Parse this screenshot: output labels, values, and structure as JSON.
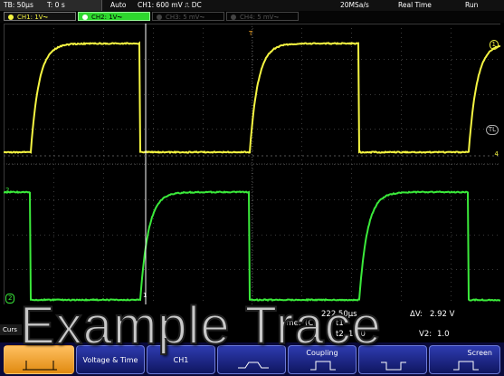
{
  "status_bar": {
    "timebase": "TB: 50µs",
    "trigger_time": "T: 0 s",
    "trigger_mode": "Auto",
    "trigger_info": "CH1: 600 mV ⎍ DC",
    "sample_rate": "20MSa/s",
    "acq_mode": "Real Time",
    "run_state": "Run"
  },
  "channel_tabs": [
    {
      "label": "CH1: 1V⏦",
      "active": false,
      "color": "#f5f542"
    },
    {
      "label": "CH2: 1V⏦",
      "active": true,
      "color": "#3bea3b"
    },
    {
      "label": "CH3: 5 mV⏦",
      "active": false,
      "color": "#555555"
    },
    {
      "label": "CH4: 5 mV⏦",
      "active": false,
      "color": "#555555"
    }
  ],
  "markers": {
    "ch1_right": "1",
    "ch1_level_right": "4",
    "ch2_zero_left": "2",
    "trigger_letter": "T",
    "trigger_right": "TL",
    "cursor_label": "1",
    "ch2_ground": "2"
  },
  "readout": {
    "time_label": "Time:",
    "channel": "(CH",
    "t1_label": "t1",
    "t1_value": "222.50µs",
    "t2_label": "t2",
    "t2_value": "1.50",
    "dv_label": "ΔV:",
    "dv_value": "2.92 V",
    "v2_label": "V2:",
    "v2_value": "1.0"
  },
  "cursors_tab": "Curs",
  "softkeys": [
    {
      "label": "",
      "icon": "cursor-type-icon",
      "active": true
    },
    {
      "label": "Voltage & Time",
      "icon": "",
      "active": false
    },
    {
      "label": "CH1",
      "icon": "",
      "active": false
    },
    {
      "label": "",
      "icon": "waveform-icon",
      "active": false
    },
    {
      "label": "Coupling",
      "icon": "pulse-icon",
      "active": false
    },
    {
      "label": "",
      "icon": "pulse-icon",
      "active": false
    },
    {
      "label": "Screen",
      "icon": "pulse-icon",
      "active": false
    }
  ],
  "overlay_text": "Example Trace",
  "colors": {
    "ch1": "#f5f542",
    "ch2": "#3bea3b",
    "grid": "#3a3a3a",
    "cursor": "#ffffff",
    "softkey_bg": "#1a2280",
    "active_key": "#f5a623"
  }
}
